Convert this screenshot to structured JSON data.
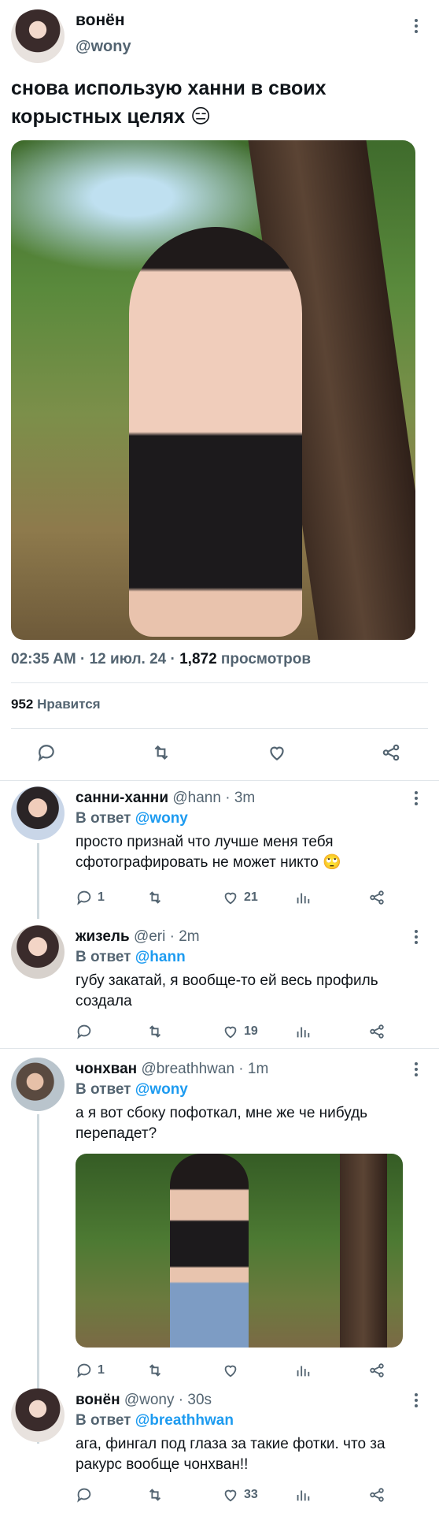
{
  "main": {
    "name": "вонён",
    "handle": "@wony",
    "text": "снова использую ханни в своих корыстных целях 😑",
    "time": "02:35 AM · 12 июл. 24 · ",
    "views_count": "1,872",
    "views_label": " просмотров",
    "likes_count": "952",
    "likes_label": " Нравится"
  },
  "replies": [
    {
      "name": "санни-ханни",
      "handle": "@hann · 3m",
      "reply_to_prefix": "В ответ ",
      "reply_to": "@wony",
      "text": "просто признай что лучше меня тебя сфотографировать не может никто 🙄",
      "replies": "1",
      "likes": "21"
    },
    {
      "name": "жизель",
      "handle": "@eri · 2m",
      "reply_to_prefix": "В ответ ",
      "reply_to": "@hann",
      "text": "губу закатай, я вообще-то ей весь профиль создала",
      "replies": "",
      "likes": "19"
    },
    {
      "name": "чонхван",
      "handle": "@breathhwan · 1m",
      "reply_to_prefix": "В ответ ",
      "reply_to": "@wony",
      "text": "а я вот сбоку пофоткал, мне же че нибудь перепадет?",
      "replies": "1",
      "likes": ""
    },
    {
      "name": "вонён",
      "handle": "@wony · 30s",
      "reply_to_prefix": "В ответ ",
      "reply_to": "@breathhwan",
      "text": "ага, фингал под глаза за такие фотки. что за ракурс вообще чонхван!!",
      "replies": "",
      "likes": "33"
    }
  ],
  "colors": {
    "accent": "#1d9bf0",
    "muted": "#536471",
    "text": "#0f1419",
    "divider": "#e1e6ea"
  }
}
